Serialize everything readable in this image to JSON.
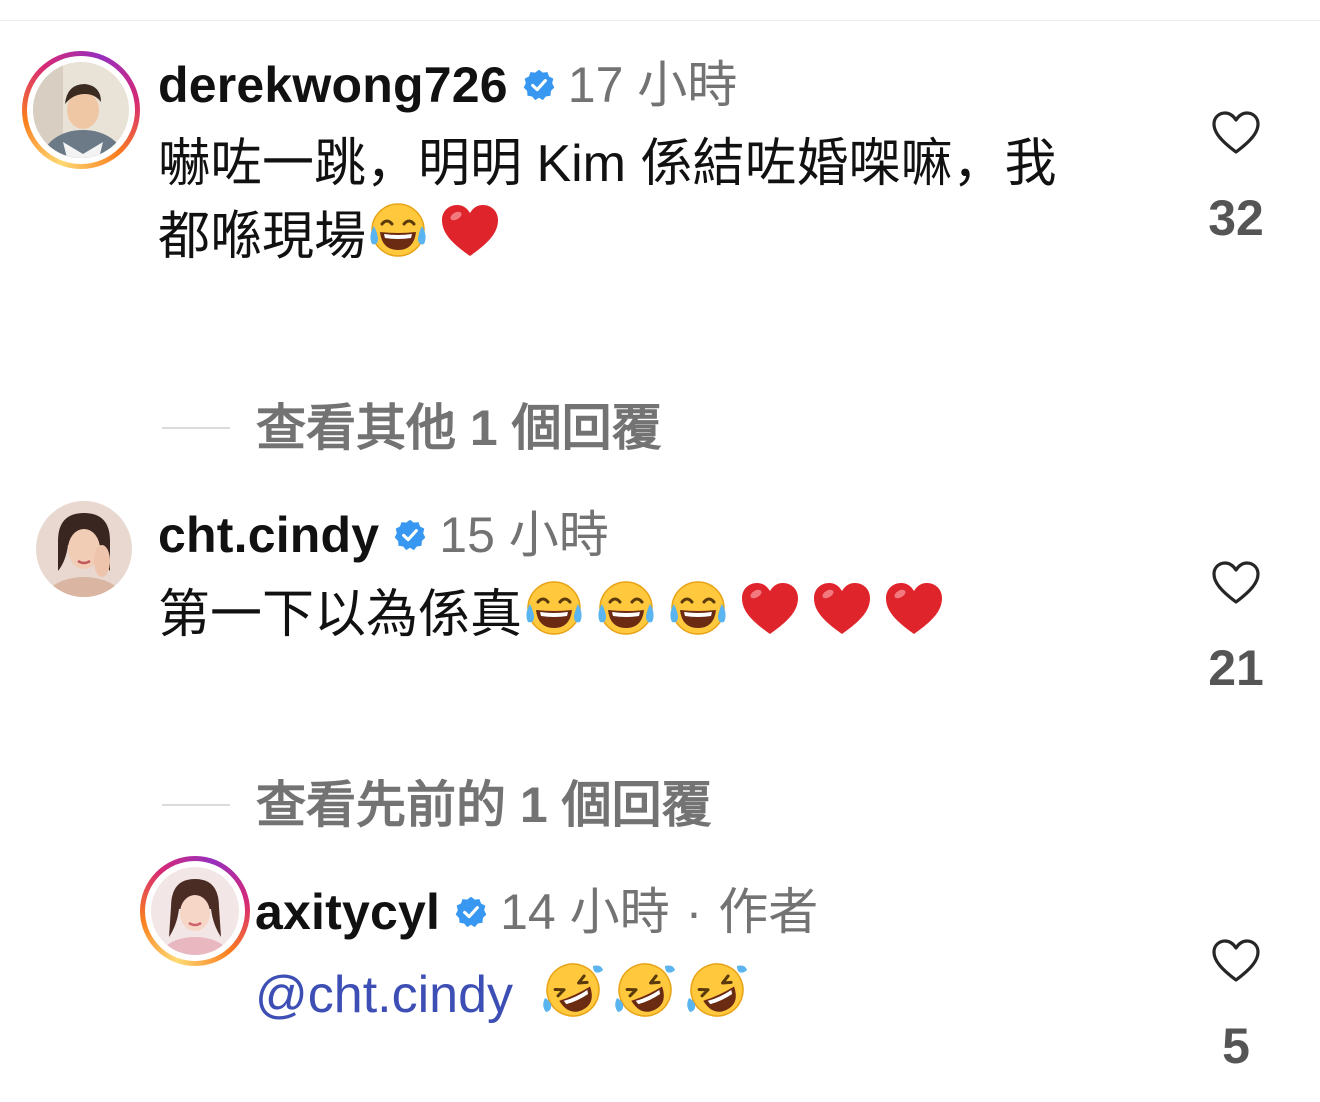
{
  "comments": [
    {
      "username": "derekwong726",
      "time": "17 小時",
      "text": "嚇咗一跳，明明 Kim 係結咗婚㗎嘛，我",
      "text2": "都喺現場",
      "emojis": [
        "joy-emoji",
        "red-heart-emoji"
      ],
      "likes": "32"
    },
    {
      "username": "cht.cindy",
      "time": "15 小時",
      "text": "第一下以為係真",
      "emojis": [
        "joy-emoji",
        "joy-emoji",
        "joy-emoji",
        "red-heart-emoji",
        "red-heart-emoji",
        "red-heart-emoji"
      ],
      "likes": "21"
    }
  ],
  "reply": {
    "username": "axitycyl",
    "time": "14 小時",
    "separator": "·",
    "author_tag": "作者",
    "mention": "@cht.cindy",
    "emojis": [
      "rofl-emoji",
      "rofl-emoji",
      "rofl-emoji"
    ],
    "likes": "5"
  },
  "view_more_replies": "查看其他 1 個回覆",
  "view_previous_replies": "查看先前的 1 個回覆",
  "colors": {
    "verified": "#3897f0",
    "mention": "#3d4fb5",
    "meta": "#737373"
  }
}
